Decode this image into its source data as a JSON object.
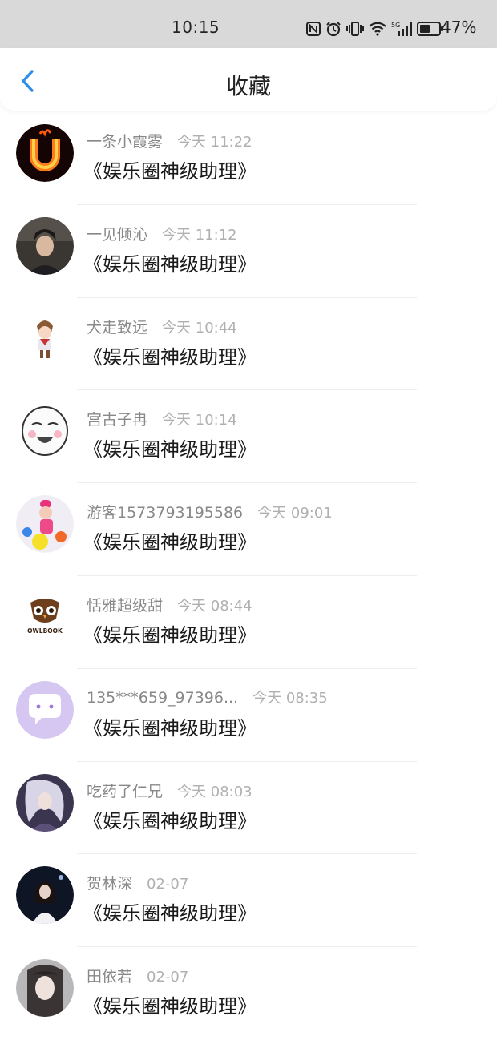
{
  "status_bar": {
    "time": "10:15",
    "battery": "47%",
    "icons": [
      "nfc-icon",
      "alarm-icon",
      "vibrate-icon",
      "wifi-icon",
      "signal-5g-icon",
      "battery-icon"
    ]
  },
  "header": {
    "back_icon": "chevron-left-icon",
    "title": "收藏"
  },
  "favorites": [
    {
      "name": "一条小霞雾",
      "time": "今天 11:22",
      "content": "《娱乐圈神级助理》"
    },
    {
      "name": "一见倾沁",
      "time": "今天 11:12",
      "content": "《娱乐圈神级助理》"
    },
    {
      "name": "犬走致远",
      "time": "今天 10:44",
      "content": "《娱乐圈神级助理》"
    },
    {
      "name": "宫古子冉",
      "time": "今天 10:14",
      "content": "《娱乐圈神级助理》"
    },
    {
      "name": "游客1573793195586",
      "time": "今天 09:01",
      "content": "《娱乐圈神级助理》"
    },
    {
      "name": "恬雅超级甜",
      "time": "今天 08:44",
      "content": "《娱乐圈神级助理》"
    },
    {
      "name": "135***659_97396...",
      "time": "今天 08:35",
      "content": "《娱乐圈神级助理》"
    },
    {
      "name": "吃药了仁兄",
      "time": "今天 08:03",
      "content": "《娱乐圈神级助理》"
    },
    {
      "name": "贺林深",
      "time": "02-07",
      "content": "《娱乐圈神级助理》"
    },
    {
      "name": "田依若",
      "time": "02-07",
      "content": "《娱乐圈神级助理》"
    }
  ],
  "avatar_logo_text": "OWLBOOK",
  "colors": {
    "accent": "#2f8fe6",
    "status_bar_bg": "#d9d9d9",
    "name_text": "#888888",
    "time_text": "#b0b0b0"
  }
}
